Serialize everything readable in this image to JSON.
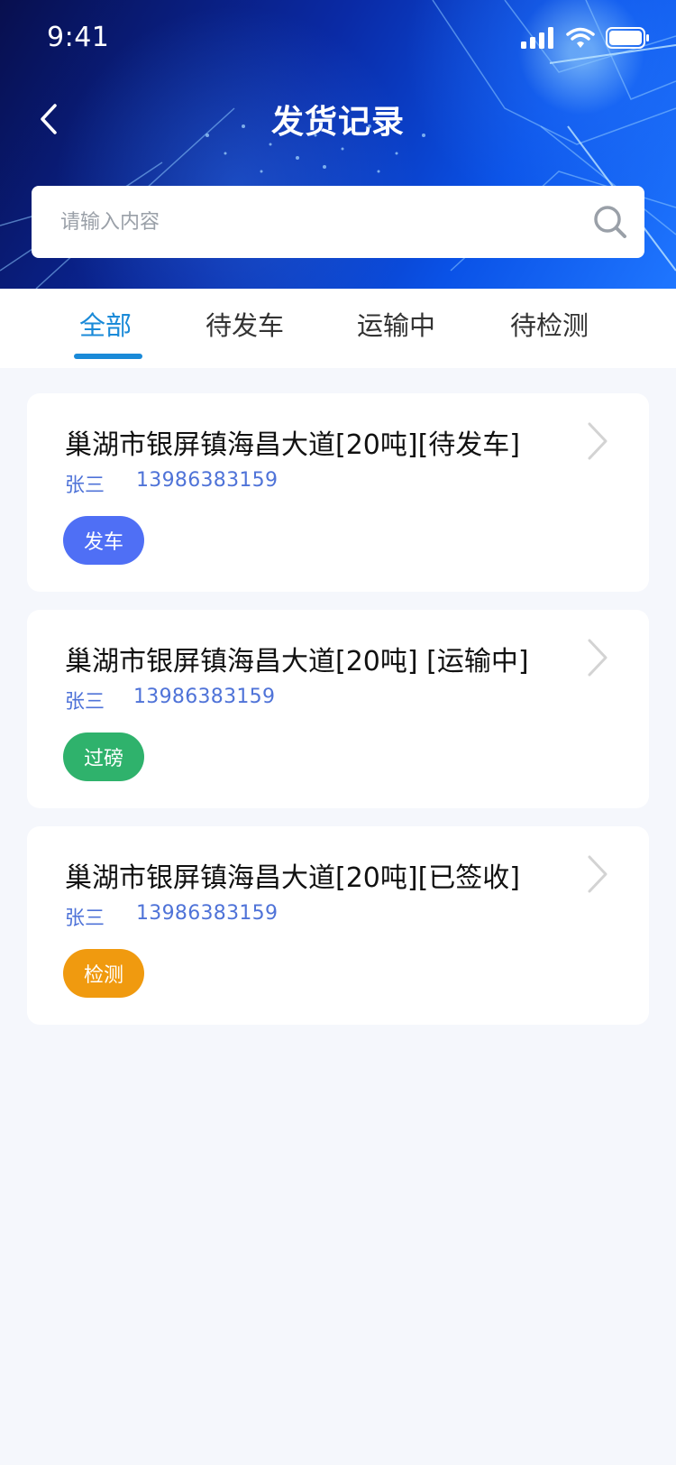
{
  "status_bar": {
    "time": "9:41"
  },
  "header": {
    "title": "发货记录"
  },
  "search": {
    "placeholder": "请输入内容"
  },
  "tabs": [
    {
      "label": "全部",
      "active": true
    },
    {
      "label": "待发车",
      "active": false
    },
    {
      "label": "运输中",
      "active": false
    },
    {
      "label": "待检测",
      "active": false
    }
  ],
  "records": [
    {
      "title": "巢湖市银屏镇海昌大道[20吨][待发车]",
      "name": "张三",
      "phone": "13986383159",
      "action": "发车",
      "action_color": "#4f6ff5"
    },
    {
      "title": "巢湖市银屏镇海昌大道[20吨] [运输中]",
      "name": "张三",
      "phone": "13986383159",
      "action": "过磅",
      "action_color": "#2fb26c"
    },
    {
      "title": "巢湖市银屏镇海昌大道[20吨][已签收]",
      "name": "张三",
      "phone": "13986383159",
      "action": "检测",
      "action_color": "#f09a0f"
    }
  ],
  "colors": {
    "accent": "#1a8ad8",
    "link": "#4f73d8",
    "background": "#f5f7fc"
  },
  "icons": [
    "back-icon",
    "search-icon",
    "chevron-right-icon",
    "signal-icon",
    "wifi-icon",
    "battery-icon"
  ]
}
